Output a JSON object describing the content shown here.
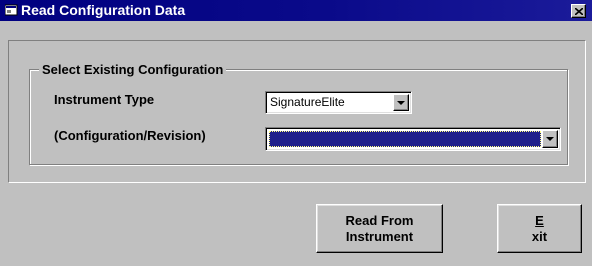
{
  "window": {
    "title": "Read Configuration Data",
    "icon": "app-window-icon",
    "close_icon": "close-icon",
    "title_color": "#000080",
    "face_color": "#c0c0c0"
  },
  "group": {
    "label": "Select Existing Configuration"
  },
  "instrument_type": {
    "label": "Instrument Type",
    "value": "SignatureElite",
    "arrow_icon": "chevron-down-icon"
  },
  "configuration": {
    "label": "(Configuration/Revision)",
    "value": "",
    "arrow_icon": "chevron-down-icon",
    "selection_color": "#1f1f8c"
  },
  "buttons": {
    "read_from_instrument": "Read From\nInstrument",
    "exit_mnemonic": "E",
    "exit_rest": "xit"
  }
}
